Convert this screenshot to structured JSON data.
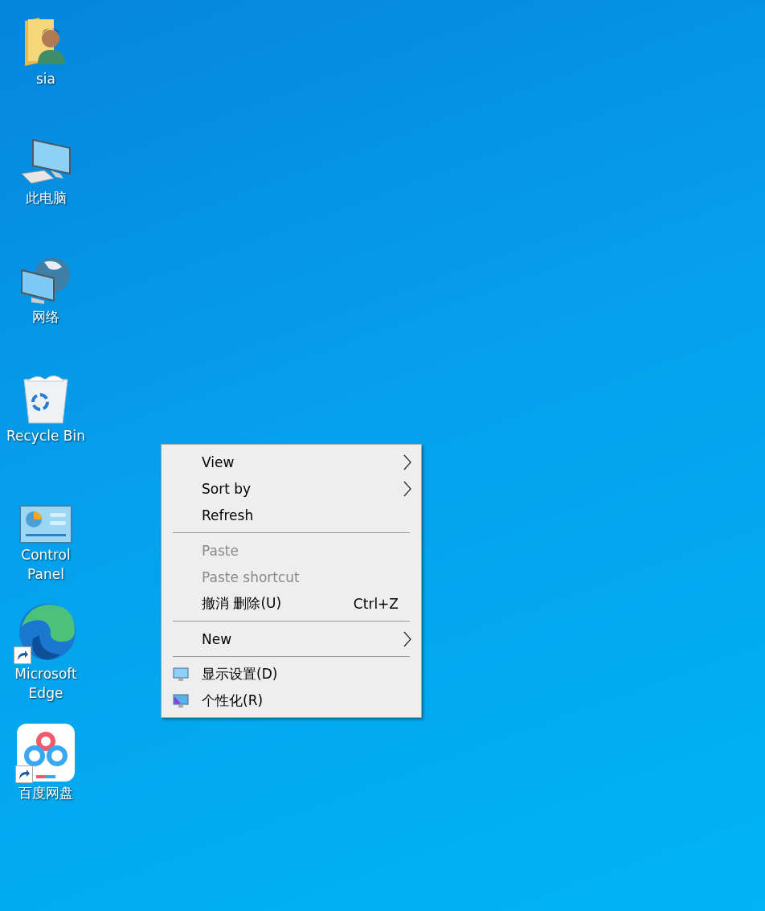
{
  "desktop_icons": [
    {
      "label": "sia",
      "kind": "user-folder",
      "shortcut": false
    },
    {
      "label": "此电脑",
      "kind": "computer",
      "shortcut": false
    },
    {
      "label": "网络",
      "kind": "network",
      "shortcut": false
    },
    {
      "label": "Recycle Bin",
      "kind": "recycle-bin",
      "shortcut": false
    },
    {
      "label": "Control Panel",
      "kind": "control-panel",
      "shortcut": false
    },
    {
      "label": "Microsoft Edge",
      "kind": "browser",
      "shortcut": true
    },
    {
      "label": "百度网盘",
      "kind": "cloud-app",
      "shortcut": true
    }
  ],
  "context_menu": {
    "items": [
      {
        "kind": "item",
        "label": "View",
        "submenu": true,
        "disabled": false
      },
      {
        "kind": "item",
        "label": "Sort by",
        "submenu": true,
        "disabled": false
      },
      {
        "kind": "item",
        "label": "Refresh",
        "submenu": false,
        "disabled": false
      },
      {
        "kind": "separator"
      },
      {
        "kind": "item",
        "label": "Paste",
        "submenu": false,
        "disabled": true
      },
      {
        "kind": "item",
        "label": "Paste shortcut",
        "submenu": false,
        "disabled": true
      },
      {
        "kind": "item",
        "label": "撤消 删除(U)",
        "shortcut": "Ctrl+Z",
        "submenu": false,
        "disabled": false
      },
      {
        "kind": "separator"
      },
      {
        "kind": "item",
        "label": "New",
        "submenu": true,
        "disabled": false
      },
      {
        "kind": "separator"
      },
      {
        "kind": "display",
        "label": "显示设置(D)",
        "submenu": false,
        "disabled": false
      },
      {
        "kind": "personalize",
        "label": "个性化(R)",
        "submenu": false,
        "disabled": false
      }
    ]
  }
}
